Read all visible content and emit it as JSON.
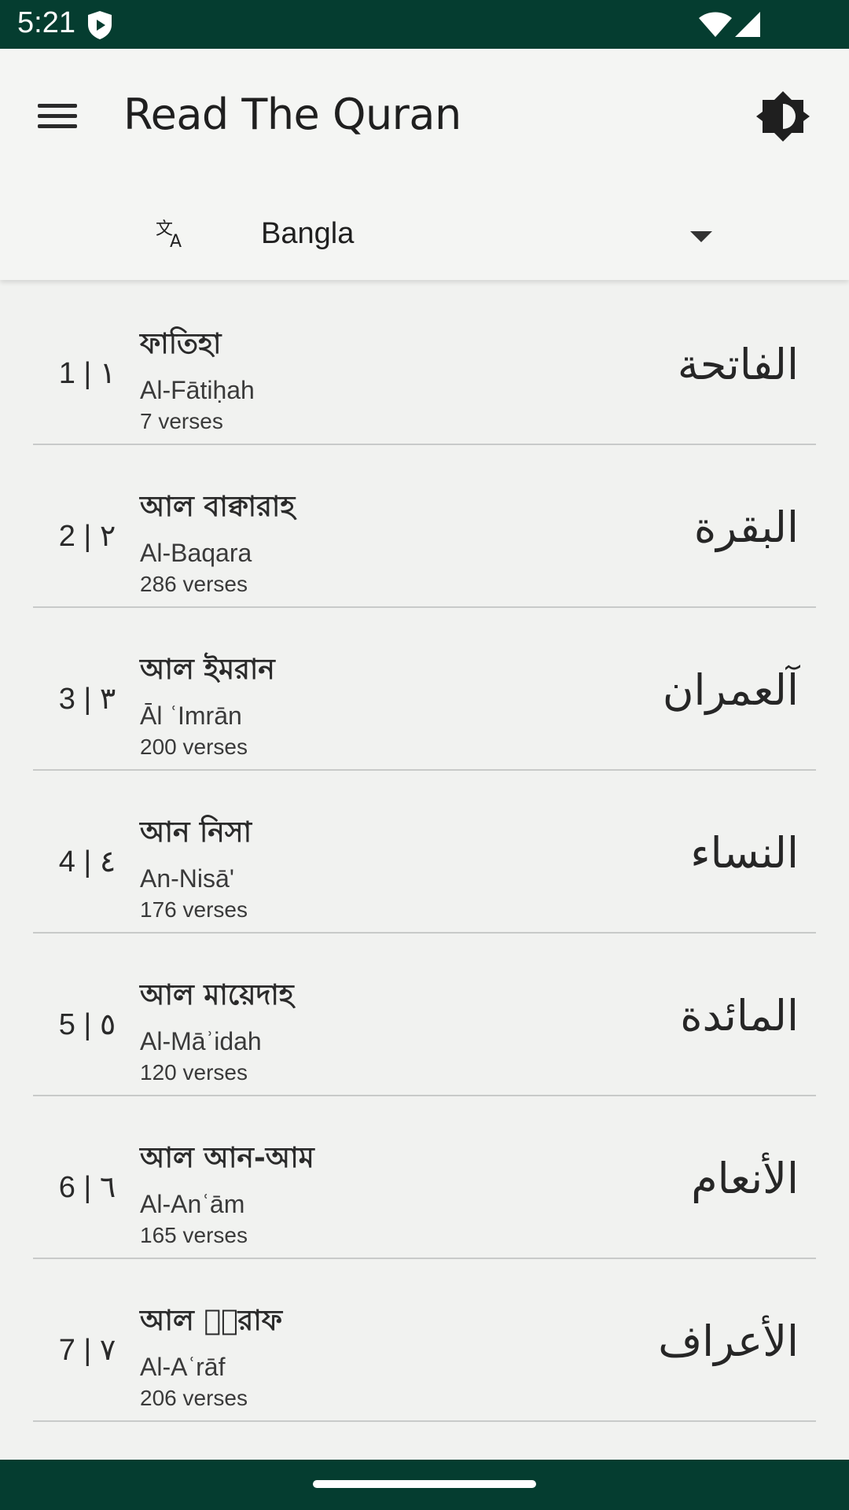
{
  "status": {
    "time": "5:21"
  },
  "app": {
    "title": "Read The Quran"
  },
  "language": {
    "selected": "Bangla"
  },
  "surahs": [
    {
      "num": "1 | ١",
      "bn": "ফাতিহা",
      "translit": "Al-Fātiḥah",
      "verses": "7 verses",
      "ar": "الفاتحة"
    },
    {
      "num": "2 | ٢",
      "bn": "আল বাক্বারাহ",
      "translit": "Al-Baqara",
      "verses": "286 verses",
      "ar": "البقرة"
    },
    {
      "num": "3 | ٣",
      "bn": "আল ইমরান",
      "translit": "Āl ʿImrān",
      "verses": "200 verses",
      "ar": "آلعمران"
    },
    {
      "num": "4 | ٤",
      "bn": "আন নিসা",
      "translit": "An-Nisā'",
      "verses": "176 verses",
      "ar": "النساء"
    },
    {
      "num": "5 | ٥",
      "bn": "আল মায়েদাহ",
      "translit": "Al-Māʾidah",
      "verses": "120 verses",
      "ar": "المائدة"
    },
    {
      "num": "6 | ٦",
      "bn": "আল আন-আম",
      "translit": "Al-Anʿām",
      "verses": "165 verses",
      "ar": "الأنعام"
    },
    {
      "num": "7 | ٧",
      "bn": "আল আ⃞রাফ",
      "translit": "Al-Aʿrāf",
      "verses": "206 verses",
      "ar": "الأعراف"
    }
  ]
}
